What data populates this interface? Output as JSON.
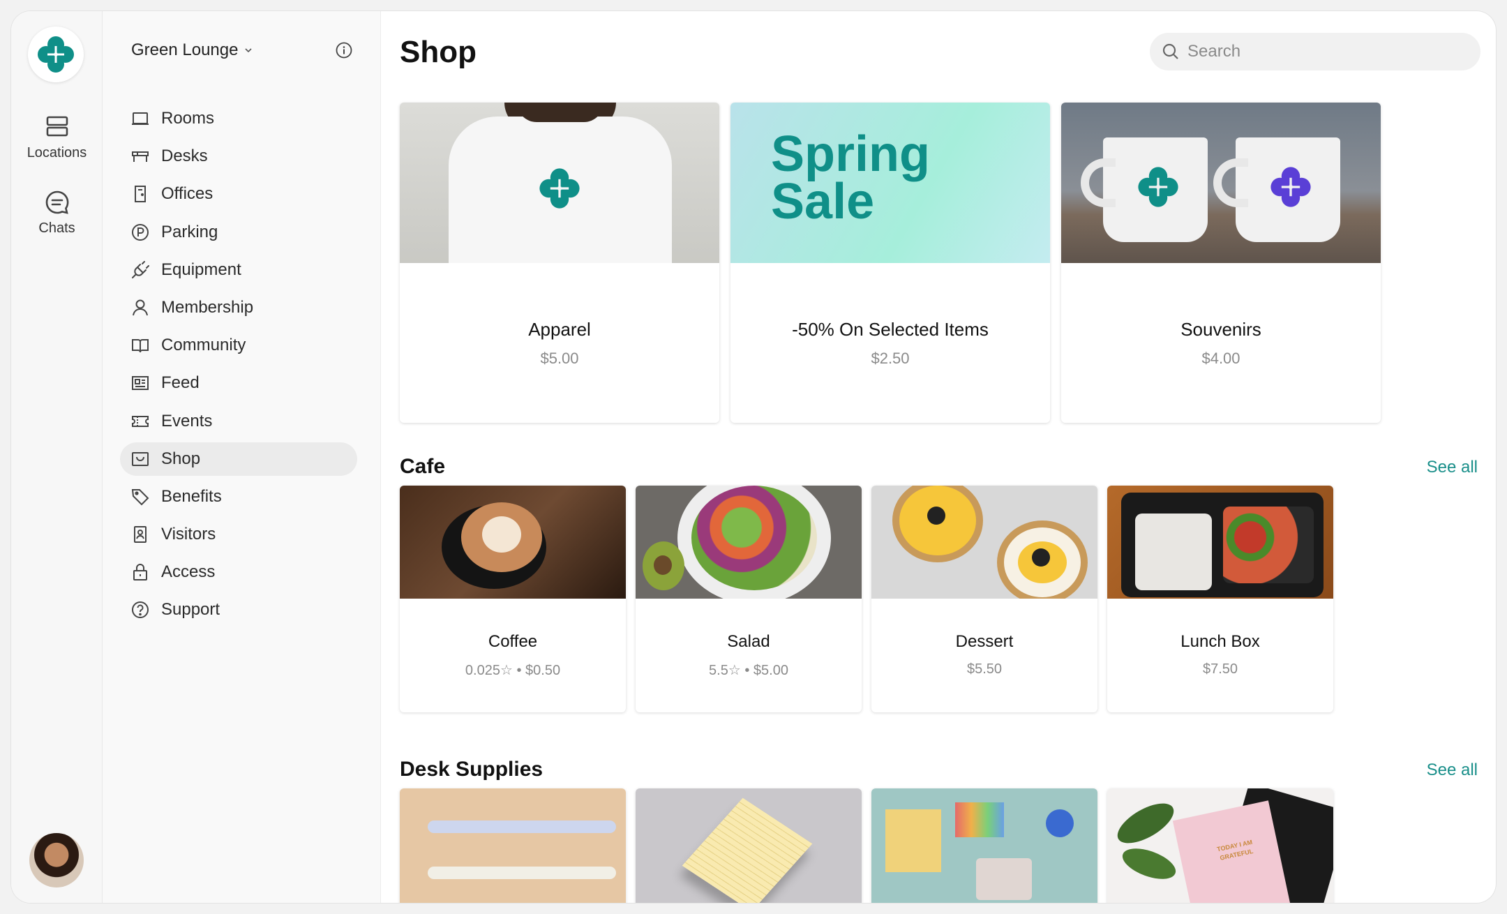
{
  "rail": {
    "items": [
      {
        "label": "Locations",
        "icon": "locations-icon"
      },
      {
        "label": "Chats",
        "icon": "chat-icon"
      }
    ]
  },
  "sidebar": {
    "workspace": "Green Lounge",
    "items": [
      {
        "label": "Rooms",
        "icon": "room-icon"
      },
      {
        "label": "Desks",
        "icon": "desk-icon"
      },
      {
        "label": "Offices",
        "icon": "office-icon"
      },
      {
        "label": "Parking",
        "icon": "parking-icon"
      },
      {
        "label": "Equipment",
        "icon": "plug-icon"
      },
      {
        "label": "Membership",
        "icon": "user-icon"
      },
      {
        "label": "Community",
        "icon": "book-icon"
      },
      {
        "label": "Feed",
        "icon": "newspaper-icon"
      },
      {
        "label": "Events",
        "icon": "ticket-icon"
      },
      {
        "label": "Shop",
        "icon": "shop-icon",
        "active": true
      },
      {
        "label": "Benefits",
        "icon": "tag-icon"
      },
      {
        "label": "Visitors",
        "icon": "badge-icon"
      },
      {
        "label": "Access",
        "icon": "lock-icon"
      },
      {
        "label": "Support",
        "icon": "help-icon"
      }
    ]
  },
  "main": {
    "title": "Shop",
    "search_placeholder": "Search",
    "featured": [
      {
        "title": "Apparel",
        "price": "$5.00"
      },
      {
        "title": "-50% On Selected Items",
        "price": "$2.50",
        "banner_text_1": "Spring",
        "banner_text_2": "Sale"
      },
      {
        "title": "Souvenirs",
        "price": "$4.00"
      }
    ],
    "cafe": {
      "title": "Cafe",
      "see_all": "See all",
      "items": [
        {
          "title": "Coffee",
          "sub": "0.025☆ • $0.50"
        },
        {
          "title": "Salad",
          "sub": "5.5☆ • $5.00"
        },
        {
          "title": "Dessert",
          "sub": "$5.50"
        },
        {
          "title": "Lunch Box",
          "sub": "$7.50"
        }
      ]
    },
    "desk_supplies": {
      "title": "Desk Supplies",
      "see_all": "See all",
      "banner_text": "TODAY I AM GRATEFUL"
    }
  },
  "colors": {
    "accent": "#0f8f88",
    "link": "#1a8f8a"
  }
}
